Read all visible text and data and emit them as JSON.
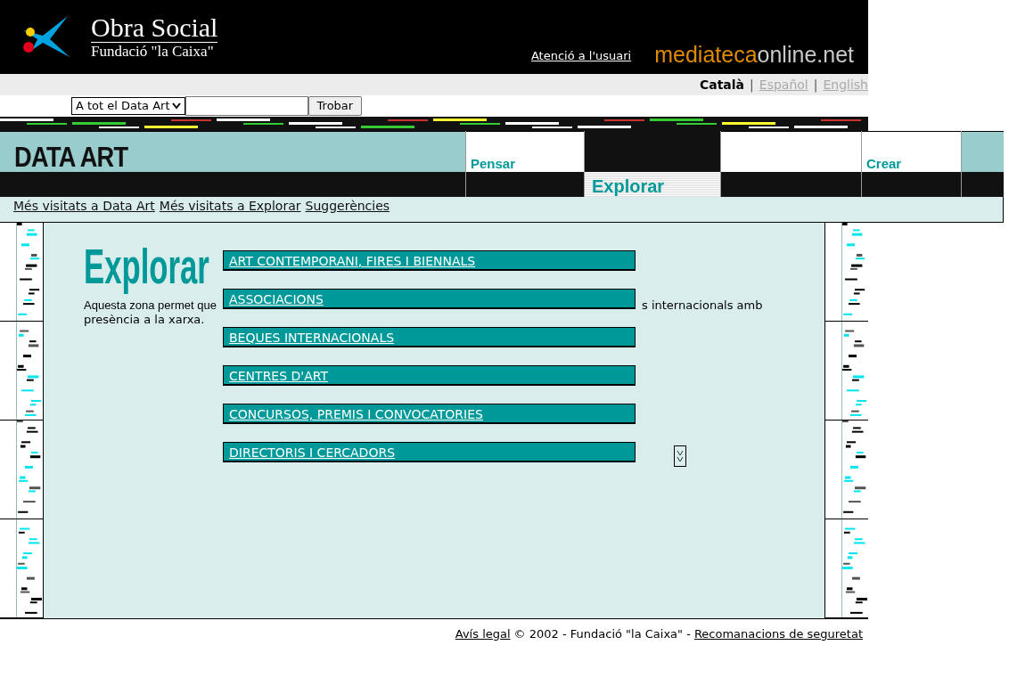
{
  "header": {
    "logo_title": "Obra Social",
    "logo_subtitle": "Fundació \"la Caixa\"",
    "help_link": "Atenció a l'usuari",
    "brand": [
      {
        "text": "mediateca",
        "color": "#e08a00"
      },
      {
        "text": "online.net",
        "color": "#c8c8c8"
      }
    ]
  },
  "languages": {
    "separator": "|",
    "items": [
      {
        "label": "Català",
        "selected": true
      },
      {
        "label": "Español",
        "selected": false
      },
      {
        "label": "English",
        "selected": false
      }
    ]
  },
  "search": {
    "scope": "A tot el Data Art",
    "button": "Trobar"
  },
  "nav": {
    "section": "DATA ART",
    "tabs": [
      {
        "label": "Pensar",
        "selected": false
      },
      {
        "label": "Explorar",
        "selected": true
      },
      {
        "label": "Crear",
        "selected": false
      }
    ]
  },
  "sub_links": [
    "Més visitats a Data Art",
    "Més visitats a Explorar",
    "Suggerències"
  ],
  "page": {
    "title": "Explorar",
    "description": [
      "Aquesta zona permet que",
      "s internacionals amb",
      "presència a la xarxa."
    ],
    "categories": [
      "ART CONTEMPORANI, FIRES I BIENNALS",
      "ASSOCIACIONS",
      "BEQUES INTERNACIONALS",
      "CENTRES D'ART",
      "CONCURSOS, PREMIS I CONVOCATORIES",
      "DIRECTORIS I CERCADORS"
    ]
  },
  "footer": [
    {
      "kind": "link",
      "text": "Avís legal"
    },
    {
      "kind": "text",
      "text": "© 2002 - Fundació \"la Caixa\" -"
    },
    {
      "kind": "link",
      "text": "Recomanacions de seguretat"
    }
  ]
}
